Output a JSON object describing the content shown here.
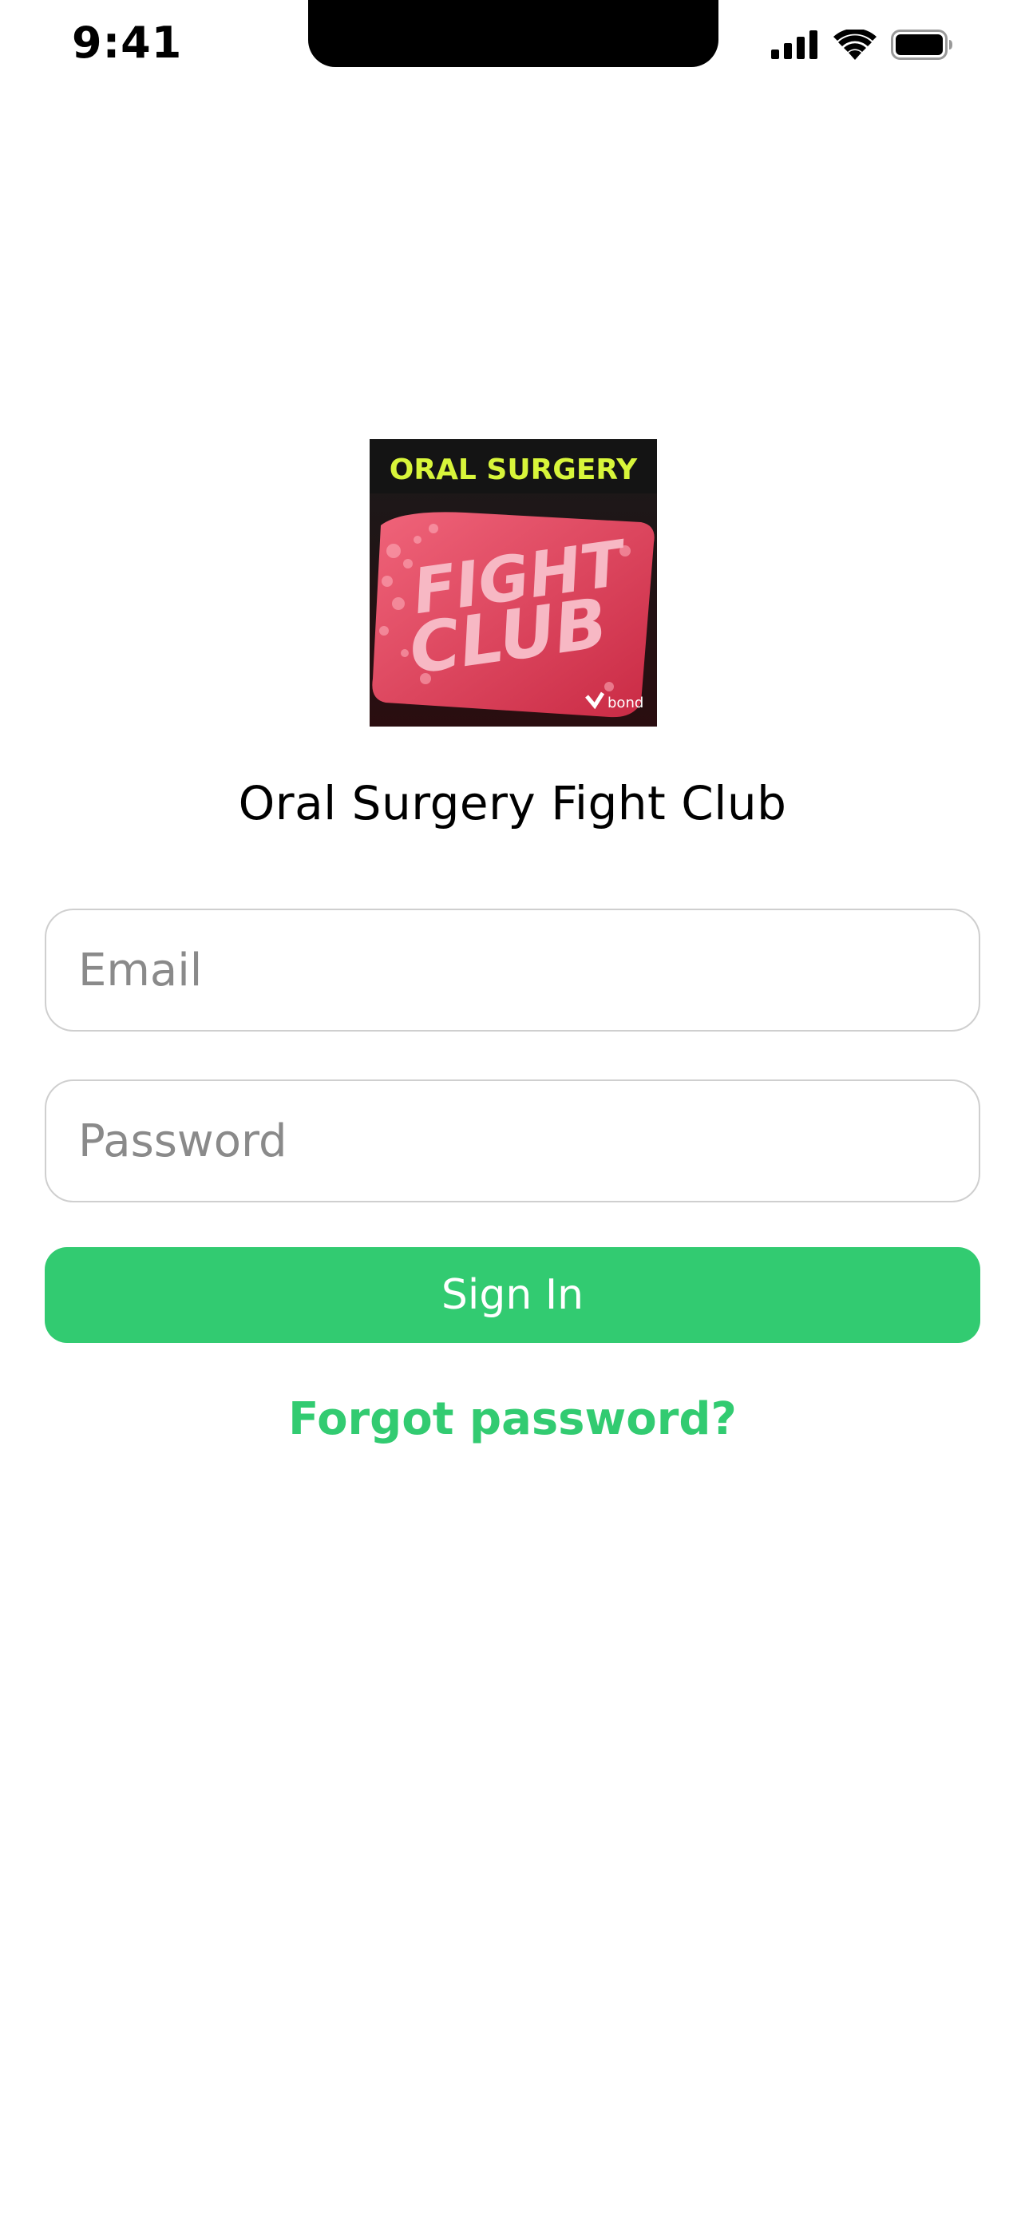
{
  "status_bar": {
    "time": "9:41"
  },
  "logo": {
    "banner_text": "ORAL SURGERY",
    "soap_text_line1": "FIGHT",
    "soap_text_line2": "CLUB",
    "watermark_text": "bond",
    "banner_color": "#d8f53a",
    "soap_color": "#e8495f"
  },
  "org": {
    "name": "Oral Surgery Fight Club"
  },
  "form": {
    "email_placeholder": "Email",
    "password_placeholder": "Password",
    "sign_in_label": "Sign In",
    "forgot_label": "Forgot password?"
  },
  "colors": {
    "accent": "#32cb71",
    "field_border": "#cfcfcf",
    "placeholder": "#8a8a8a"
  },
  "icons": [
    "cellular-signal-icon",
    "wifi-icon",
    "battery-icon"
  ]
}
